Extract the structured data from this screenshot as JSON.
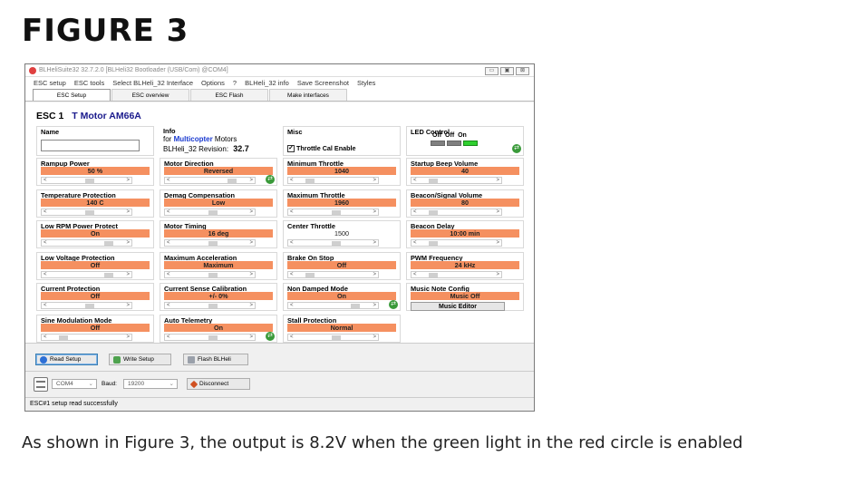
{
  "figure_title": "FIGURE 3",
  "caption": "As shown in Figure 3, the output is 8.2V when the green light in the red circle is enabled",
  "window": {
    "title": "BLHeliSuite32 32.7.2.0  [BLHeli32 Bootloader (USB/Com) @COM4]",
    "buttons": [
      "▭",
      "▣",
      "⊠"
    ]
  },
  "menu": [
    "ESC setup",
    "ESC tools",
    "Select BLHeli_32 Interface",
    "Options",
    "?",
    "BLHeli_32 info",
    "Save Screenshot",
    "Styles"
  ],
  "tabs": [
    "ESC Setup",
    "ESC overview",
    "ESC Flash",
    "Make interfaces"
  ],
  "esc": {
    "label": "ESC 1",
    "model": "T Motor AM66A"
  },
  "name_box": {
    "label": "Name"
  },
  "info_box": {
    "label": "Info",
    "for_prefix": "for",
    "for_value": "Multicopter",
    "for_suffix": "Motors",
    "rev_label": "BLHeli_32 Revision:",
    "rev_value": "32.7"
  },
  "misc_box": {
    "label": "Misc",
    "checkbox_label": "Throttle Cal Enable",
    "checked": true
  },
  "led_box": {
    "label": "LED Control",
    "states": "Off  Off  On"
  },
  "params": [
    {
      "label": "Rampup Power",
      "value": "50 %"
    },
    {
      "label": "Motor Direction",
      "value": "Reversed"
    },
    {
      "label": "Minimum Throttle",
      "value": "1040"
    },
    {
      "label": "Startup Beep Volume",
      "value": "40"
    },
    {
      "label": "Temperature Protection",
      "value": "140 C"
    },
    {
      "label": "Demag Compensation",
      "value": "Low"
    },
    {
      "label": "Maximum Throttle",
      "value": "1960"
    },
    {
      "label": "Beacon/Signal Volume",
      "value": "80"
    },
    {
      "label": "Low RPM Power Protect",
      "value": "On"
    },
    {
      "label": "Motor Timing",
      "value": "16 deg"
    },
    {
      "label": "Center Throttle",
      "value": "1500"
    },
    {
      "label": "Beacon Delay",
      "value": "10:00 min"
    },
    {
      "label": "Low Voltage Protection",
      "value": "Off"
    },
    {
      "label": "Maximum Acceleration",
      "value": "Maximum"
    },
    {
      "label": "Brake On Stop",
      "value": "Off"
    },
    {
      "label": "PWM Frequency",
      "value": "24 kHz"
    },
    {
      "label": "Current Protection",
      "value": "Off"
    },
    {
      "label": "Current Sense Calibration",
      "value": "+/- 0%"
    },
    {
      "label": "Non Damped Mode",
      "value": "On"
    },
    {
      "label": "Music Note Config",
      "value": "Music Off",
      "button": "Music Editor"
    },
    {
      "label": "Sine Modulation Mode",
      "value": "Off"
    },
    {
      "label": "Auto Telemetry",
      "value": "On"
    },
    {
      "label": "Stall Protection",
      "value": "Normal"
    }
  ],
  "slider_arrows": {
    "left": "<",
    "right": ">"
  },
  "plug_icon": "⇄",
  "actions": {
    "read": "Read Setup",
    "write": "Write Setup",
    "flash": "Flash BLHeli"
  },
  "com": {
    "port": "COM4",
    "baud_label": "Baud:",
    "baud": "19200",
    "disconnect": "Disconnect"
  },
  "status": "ESC#1 setup read successfully",
  "colors": {
    "value_bg": "#f59060",
    "led_on": "#2fd02f",
    "led_off": "#808080"
  }
}
